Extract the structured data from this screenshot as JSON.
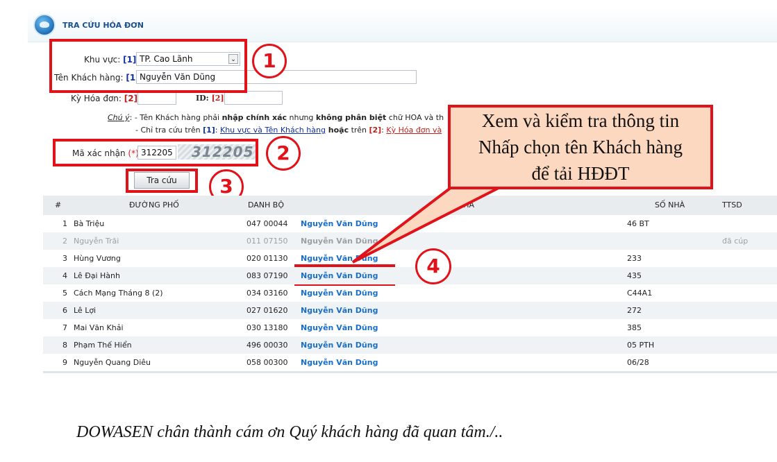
{
  "header": {
    "title": "TRA CỨU HÓA ĐƠN"
  },
  "form": {
    "area_label": "Khu vực:",
    "area_ref": "[1]",
    "area_value": "TP. Cao Lãnh",
    "customer_label": "Tên Khách hàng:",
    "customer_ref": "[1]",
    "customer_value": "Nguyễn Văn Dũng",
    "period_label": "Kỳ Hóa đơn:",
    "period_ref": "[2]",
    "id_label": "ID:",
    "id_ref": "[2]",
    "note_title": "Chú ý",
    "note_line1_a": ": - Tên Khách hàng phải ",
    "note_line1_b": "nhập chính xác",
    "note_line1_c": " nhưng ",
    "note_line1_d": "không phân biệt",
    "note_line1_e": " chữ HOA và th",
    "note_line2_a": "- Chỉ tra cứu trên ",
    "note_line2_ref1": "[1]",
    "note_line2_b": ": ",
    "note_line2_link1": "Khu vực và Tên Khách hàng",
    "note_line2_c": " hoặc",
    "note_line2_d": " trên ",
    "note_line2_ref2": "[2]",
    "note_line2_e": ": ",
    "note_line2_link2": "Kỳ Hóa đơn và",
    "captcha_label": "Mã xác nhận",
    "captcha_req": "(*)",
    "captcha_value": "312205",
    "captcha_image_text": "312205",
    "search_button": "Tra cứu"
  },
  "steps": [
    "1",
    "2",
    "3",
    "4"
  ],
  "callout": {
    "line1": "Xem và kiểm tra thông tin",
    "line2": "Nhấp chọn tên Khách hàng",
    "line3": "để tải HĐĐT"
  },
  "table": {
    "headers": [
      "#",
      "ĐƯỜNG PHỐ",
      "DANH BỘ",
      "KHÁCH HÀ",
      "SỐ NHÀ",
      "TTSD"
    ],
    "rows": [
      {
        "n": "1",
        "street": "Bà Triệu",
        "code": "047 00044",
        "customer": "Nguyễn Văn Dũng",
        "house": "46 BT",
        "status": ""
      },
      {
        "n": "2",
        "street": "Nguyễn Trãi",
        "code": "011 07150",
        "customer": "Nguyễn Văn Dũng",
        "house": "",
        "status": "đã cúp"
      },
      {
        "n": "3",
        "street": "Hùng Vương",
        "code": "020 01130",
        "customer": "Nguyễn Văn Dũng",
        "house": "233",
        "status": ""
      },
      {
        "n": "4",
        "street": "Lê Đại Hành",
        "code": "083 07190",
        "customer": "Nguyễn Văn Dũng",
        "house": "435",
        "status": ""
      },
      {
        "n": "5",
        "street": "Cách Mạng Tháng 8 (2)",
        "code": "034 03160",
        "customer": "Nguyễn Văn Dũng",
        "house": "C44A1",
        "status": ""
      },
      {
        "n": "6",
        "street": "Lê Lợi",
        "code": "027 01620",
        "customer": "Nguyễn Văn Dũng",
        "house": "272",
        "status": ""
      },
      {
        "n": "7",
        "street": "Mai Văn Khải",
        "code": "030 13180",
        "customer": "Nguyễn Văn Dũng",
        "house": "385",
        "status": ""
      },
      {
        "n": "8",
        "street": "Phạm Thế Hiển",
        "code": "496 00030",
        "customer": "Nguyễn Văn Dũng",
        "house": "05 PTH",
        "status": ""
      },
      {
        "n": "9",
        "street": "Nguyễn Quang Diêu",
        "code": "058 00300",
        "customer": "Nguyễn Văn Dũng",
        "house": "06/28",
        "status": ""
      }
    ]
  },
  "footer": {
    "text": "DOWASEN chân thành cám ơn Quý khách hàng đã quan tâm./.."
  },
  "colors": {
    "annotation_red": "#e0131b",
    "link_blue": "#1a6fc8",
    "callout_fill": "#fcd8c0"
  }
}
